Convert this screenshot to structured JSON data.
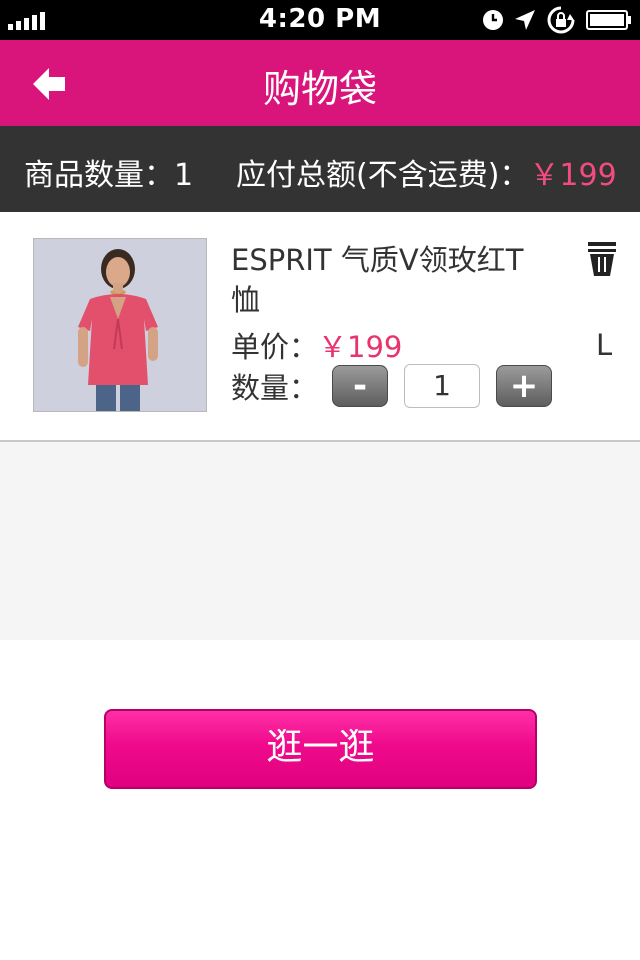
{
  "status_bar": {
    "time": "4:20 PM",
    "icons": [
      "signal-icon",
      "clock-icon",
      "location-icon",
      "rotation-lock-icon",
      "battery-icon"
    ]
  },
  "navbar": {
    "title": "购物袋",
    "back_icon": "back-arrow-icon",
    "background": "#d9157c"
  },
  "summary": {
    "count_label": "商品数量：1",
    "total_label": "应付总额(不含运费)：",
    "total_amount": "￥199",
    "amount_color": "#f24b7e"
  },
  "cart_item": {
    "name": "ESPRIT  气质V领玫红T恤",
    "price_label": "单价：",
    "price": "￥199",
    "quantity_label": "数量：",
    "quantity": "1",
    "minus": "-",
    "plus": "+",
    "size": "L",
    "delete_icon": "trash-icon",
    "image": "product-photo"
  },
  "browse_button": {
    "label": "逛一逛"
  }
}
